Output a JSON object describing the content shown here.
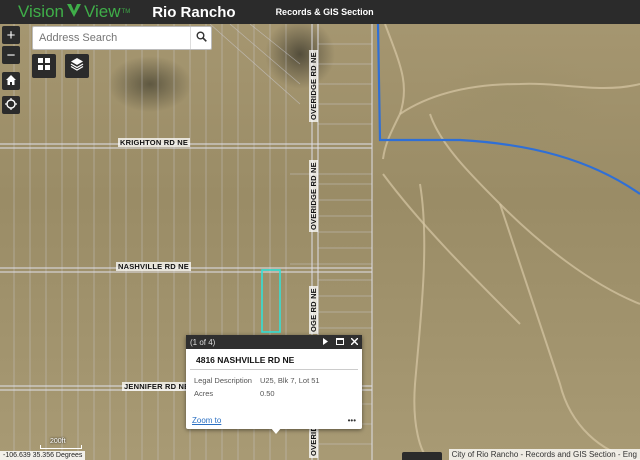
{
  "header": {
    "logo_vision": "Vision",
    "logo_view": "View",
    "logo_tm": "TM",
    "city": "Rio Rancho",
    "section": "Records & GIS Section"
  },
  "controls": {
    "zoom_in": "+",
    "zoom_out": "−"
  },
  "search": {
    "placeholder": "Address Search"
  },
  "roads": {
    "krighton": "KRIGHTON RD NE",
    "nashville": "NASHVILLE RD NE",
    "jennifer": "JENNIFER RD NE",
    "overidge_top": "OVERIDGE RD NE",
    "overidge_mid": "OVERIDGE RD NE",
    "overidge_low": "OVERIDGE RD NE",
    "overidge_popup": "OGE RD NE",
    "overidge_bottom": "OVERID"
  },
  "popup": {
    "counter": "(1 of 4)",
    "title": "4816 NASHVILLE RD NE",
    "rows": [
      {
        "label": "Legal Description",
        "value": "U25, Blk 7, Lot 51"
      },
      {
        "label": "Acres",
        "value": "0.50"
      }
    ],
    "zoom_link": "Zoom to",
    "more": "•••"
  },
  "status": {
    "coordinates": "-106.639 35.356 Degrees",
    "scale": "200ft",
    "attribution": "City of Rio Rancho - Records and GIS Section - Eng"
  },
  "colors": {
    "header_bg": "#2b2b2b",
    "logo_green": "#3fae49",
    "boundary_blue": "#2f6fd6",
    "selection_cyan": "#34e0d6"
  }
}
